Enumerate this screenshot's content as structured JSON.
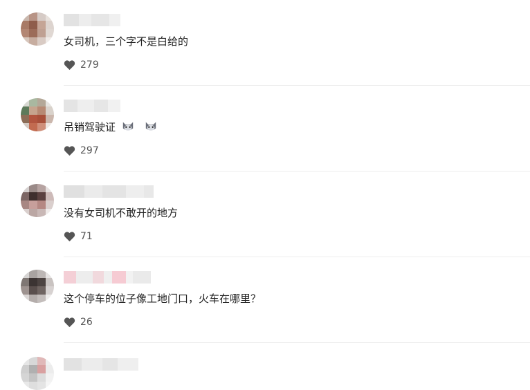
{
  "comments": [
    {
      "text": "女司机，三个字不是白给的",
      "likes": "279",
      "emojis": []
    },
    {
      "text": "吊销驾驶证",
      "likes": "297",
      "emojis": [
        "cat-emoji",
        "cat-emoji"
      ]
    },
    {
      "text": "没有女司机不敢开的地方",
      "likes": "71",
      "emojis": []
    },
    {
      "text": "这个停车的位子像工地门口，火车在哪里？",
      "likes": "26",
      "emojis": []
    }
  ],
  "icons": {
    "like": "heart-icon"
  },
  "colors": {
    "heart": "#555555",
    "divider": "#ececec"
  }
}
